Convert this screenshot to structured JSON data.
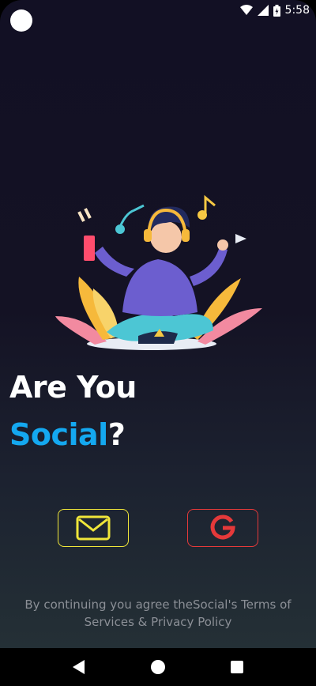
{
  "status_bar": {
    "time": "5:58",
    "icons": [
      "wifi-icon",
      "signal-icon",
      "battery-icon"
    ]
  },
  "headline": {
    "line1": "Are You",
    "accent": "Social",
    "suffix": "?"
  },
  "buttons": [
    {
      "name": "email",
      "icon": "mail-icon",
      "color": "#f0e63a"
    },
    {
      "name": "google",
      "icon": "google-g-icon",
      "color": "#e5393a"
    }
  ],
  "terms": "By continuing you agree theSocial's Terms of Services & Privacy Policy",
  "colors": {
    "accent": "#14a8f0",
    "email_border": "#f0e63a",
    "google_border": "#e5393a",
    "background_top": "#121024",
    "background_bottom": "#263337"
  },
  "nav_bar": {
    "buttons": [
      "back-icon",
      "home-icon",
      "recents-icon"
    ]
  }
}
